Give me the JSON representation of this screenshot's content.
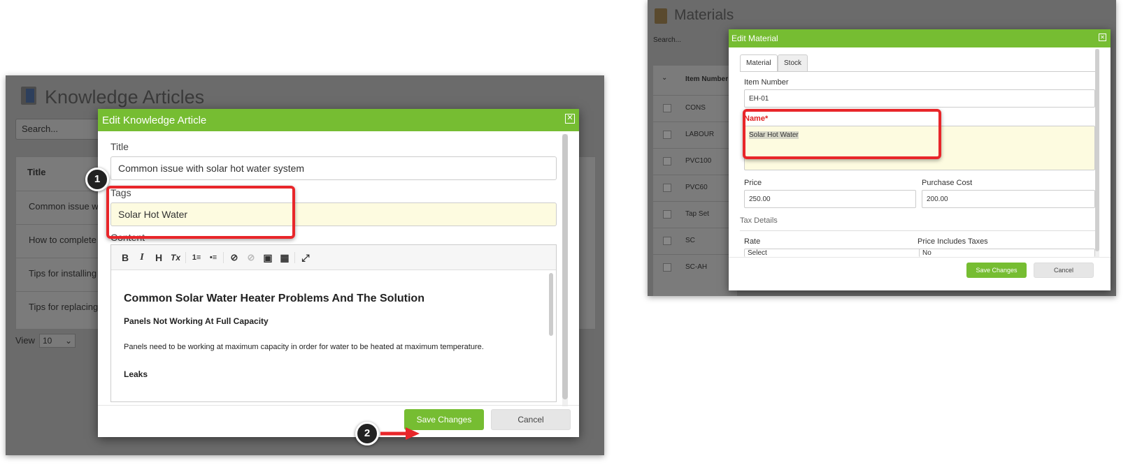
{
  "left": {
    "page_title": "Knowledge Articles",
    "search_placeholder": "Search...",
    "table": {
      "header_title": "Title",
      "rows": [
        "Common issue wit",
        "How to complete a",
        "Tips for installing a",
        "Tips for replacing"
      ]
    },
    "view_label": "View",
    "view_value": "10",
    "modal": {
      "title": "Edit Knowledge Article",
      "close_symbol": "✕",
      "title_label": "Title",
      "title_value": "Common issue with solar hot water system",
      "tags_label": "Tags",
      "tags_value": "Solar Hot Water",
      "content_label": "Content",
      "toolbar": {
        "bold": "B",
        "italic": "I",
        "heading": "H",
        "clear_format": "Tx",
        "ordered_list": "1≡",
        "bullet_list": "•≡",
        "link": "⊘",
        "unlink": "⊘",
        "image": "▣",
        "table": "▦",
        "fullscreen": "⤢"
      },
      "content": {
        "heading": "Common Solar Water Heater Problems And The Solution",
        "subheading": "Panels Not Working At Full Capacity",
        "paragraph": "Panels need to be working at maximum capacity in order for water to be heated at maximum temperature.",
        "subheading2": "Leaks"
      },
      "save_label": "Save Changes",
      "cancel_label": "Cancel"
    },
    "annotations": {
      "step1": "1",
      "step2": "2"
    }
  },
  "right": {
    "page_title": "Materials",
    "search_placeholder": "Search...",
    "table_header": "Item Number",
    "rows": [
      "CONS",
      "LABOUR",
      "PVC100",
      "PVC60",
      "Tap Set",
      "SC",
      "SC-AH"
    ],
    "modal": {
      "title": "Edit Material",
      "close_symbol": "✕",
      "tabs": [
        "Material",
        "Stock"
      ],
      "item_number_label": "Item Number",
      "item_number_value": "EH-01",
      "name_label": "Name*",
      "name_value": "Solar Hot Water",
      "price_label": "Price",
      "price_value": "250.00",
      "purchase_cost_label": "Purchase Cost",
      "purchase_cost_value": "200.00",
      "tax_details_label": "Tax Details",
      "rate_label": "Rate",
      "rate_value": "Select",
      "price_includes_label": "Price Includes Taxes",
      "price_includes_value": "No",
      "save_label": "Save Changes",
      "cancel_label": "Cancel"
    }
  },
  "colors": {
    "accent_green": "#76bd32",
    "highlight_red": "#e8262a",
    "field_yellow": "#fdfbe0"
  }
}
